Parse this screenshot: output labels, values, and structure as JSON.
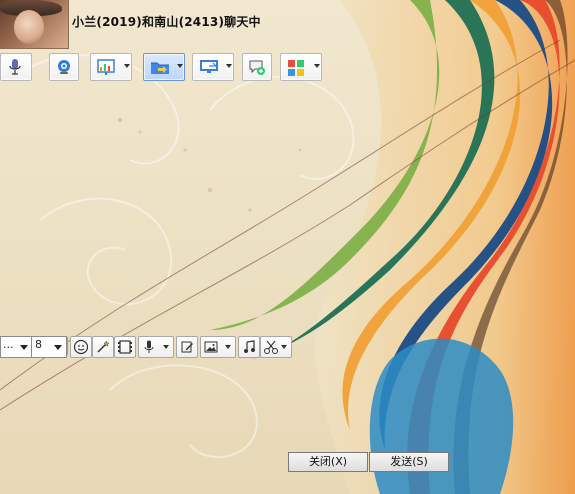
{
  "window": {
    "title": "小兰(2019)和南山(2413)聊天中"
  },
  "toolbar": {
    "items": [
      {
        "icon": "microphone-icon"
      },
      {
        "icon": "webcam-icon"
      },
      {
        "icon": "slideshow-icon"
      },
      {
        "icon": "folder-transfer-icon"
      },
      {
        "icon": "remote-desktop-icon"
      },
      {
        "icon": "new-message-icon"
      },
      {
        "icon": "apps-icon"
      }
    ]
  },
  "format_bar": {
    "font_name_value": "...",
    "font_size_value": "8"
  },
  "buttons": {
    "close_label": "关闭(X)",
    "send_label": "发送(S)"
  }
}
